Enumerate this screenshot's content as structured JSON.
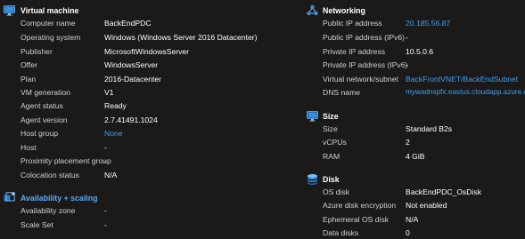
{
  "vm": {
    "title": "Virtual machine",
    "rows": [
      {
        "label": "Computer name",
        "value": "BackEndPDC"
      },
      {
        "label": "Operating system",
        "value": "Windows (Windows Server 2016 Datacenter)"
      },
      {
        "label": "Publisher",
        "value": "MicrosoftWindowsServer"
      },
      {
        "label": "Offer",
        "value": "WindowsServer"
      },
      {
        "label": "Plan",
        "value": "2016-Datacenter"
      },
      {
        "label": "VM generation",
        "value": "V1"
      },
      {
        "label": "Agent status",
        "value": "Ready"
      },
      {
        "label": "Agent version",
        "value": "2.7.41491.1024"
      },
      {
        "label": "Host group",
        "value": "None"
      },
      {
        "label": "Host",
        "value": "-"
      },
      {
        "label": "Proximity placement group",
        "value": "-"
      },
      {
        "label": "Colocation status",
        "value": "N/A"
      }
    ]
  },
  "availability": {
    "title": "Availability + scaling",
    "rows": [
      {
        "label": "Availability zone",
        "value": "-"
      },
      {
        "label": "Scale Set",
        "value": "-"
      }
    ]
  },
  "networking": {
    "title": "Networking",
    "rows": [
      {
        "label": "Public IP address",
        "value": "20.185.56.87"
      },
      {
        "label": "Public IP address (IPv6)",
        "value": "-"
      },
      {
        "label": "Private IP address",
        "value": "10.5.0.6"
      },
      {
        "label": "Private IP address (IPv6)",
        "value": "-"
      },
      {
        "label": "Virtual network/subnet",
        "value": "BackFrontVNET/BackEndSubnet"
      },
      {
        "label": "DNS name",
        "value": "mywadnspfx.eastus.cloudapp.azure.com"
      }
    ]
  },
  "size": {
    "title": "Size",
    "rows": [
      {
        "label": "Size",
        "value": "Standard B2s"
      },
      {
        "label": "vCPUs",
        "value": "2"
      },
      {
        "label": "RAM",
        "value": "4 GiB"
      }
    ]
  },
  "disk": {
    "title": "Disk",
    "rows": [
      {
        "label": "OS disk",
        "value": "BackEndPDC_OsDisk"
      },
      {
        "label": "Azure disk encryption",
        "value": "Not enabled"
      },
      {
        "label": "Ephemeral OS disk",
        "value": "N/A"
      },
      {
        "label": "Data disks",
        "value": "0"
      }
    ]
  },
  "colors": {
    "background": "#1b1a19",
    "label": "#d2d0ce",
    "value": "#ffffff",
    "link": "#3aa0f3",
    "icon_blue": "#50a0e6"
  },
  "icons": {
    "vm": "monitor-icon",
    "availability": "scale-icon",
    "networking": "network-icon",
    "size": "monitor-icon",
    "disk": "disk-stack-icon"
  }
}
